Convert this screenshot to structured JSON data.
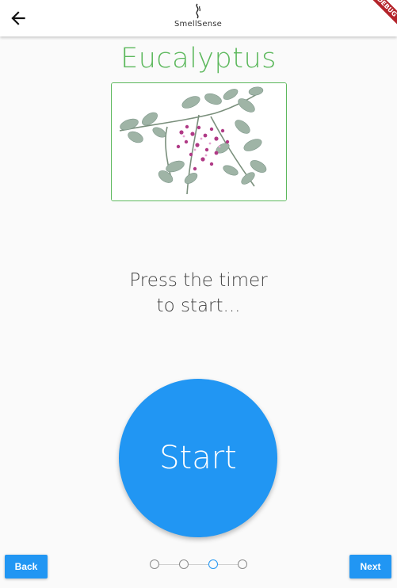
{
  "app": {
    "logo_text": "SmellSense",
    "debug_banner": "DEBUG"
  },
  "scent": {
    "name": "Eucalyptus",
    "image_alt": "Eucalyptus sprig with small pink flowers"
  },
  "instruction": {
    "line1": "Press the timer",
    "line2": "to start..."
  },
  "timer": {
    "button_label": "Start"
  },
  "navigation": {
    "back_label": "Back",
    "next_label": "Next",
    "steps_total": 4,
    "current_step": 3
  },
  "colors": {
    "accent": "#2196f3",
    "title_green": "#5cb85c",
    "background": "#fafafa"
  }
}
